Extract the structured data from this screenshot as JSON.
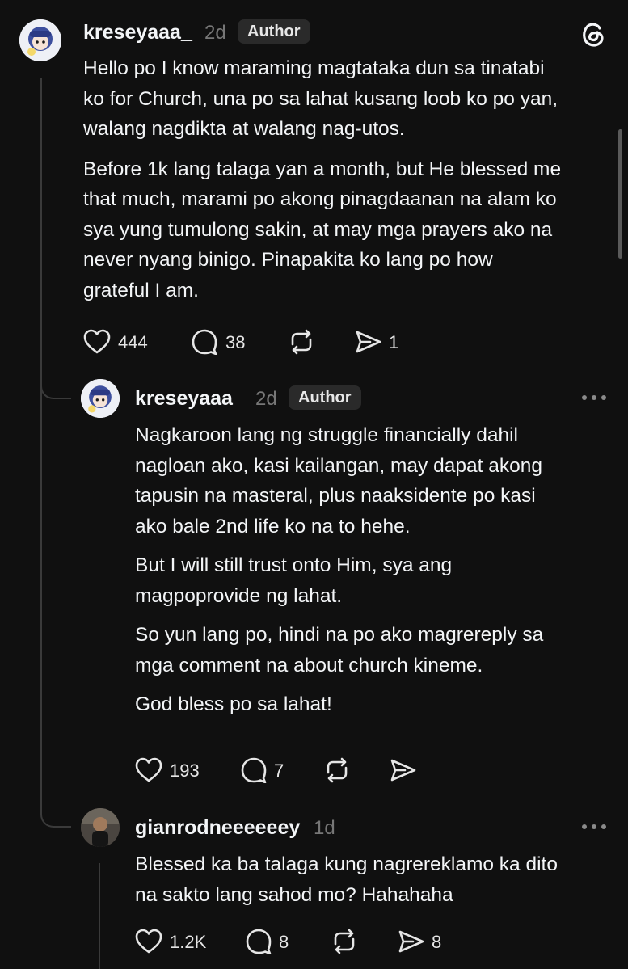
{
  "post": {
    "username": "kreseyaaa_",
    "time": "2d",
    "badge": "Author",
    "paragraphs": [
      [
        "Hello po I know maraming magtataka dun sa tinatabi",
        "ko for Church, una po sa lahat kusang loob ko po yan,",
        "walang nagdikta at walang nag-utos."
      ],
      [
        "Before 1k lang talaga yan a month, but He blessed me",
        "that much, marami po akong pinagdaanan na alam ko",
        "sya yung tumulong sakin, at may mga prayers ako na",
        "never nyang binigo. Pinapakita ko lang po how",
        "grateful I am."
      ]
    ],
    "likes": "444",
    "comments": "38",
    "shares": "1"
  },
  "reply1": {
    "username": "kreseyaaa_",
    "time": "2d",
    "badge": "Author",
    "paragraphs": [
      [
        "Nagkaroon lang ng struggle financially dahil",
        "nagloan ako, kasi kailangan, may dapat akong",
        "tapusin na masteral, plus naaksidente po kasi",
        "ako bale 2nd life ko na to hehe."
      ],
      [
        "But I will still trust onto Him, sya ang",
        "magpoprovide ng lahat."
      ],
      [
        "So yun lang po, hindi na po ako magrereply sa",
        "mga comment na about church kineme."
      ],
      [
        "God bless po sa lahat!"
      ]
    ],
    "likes": "193",
    "comments": "7"
  },
  "reply2": {
    "username": "gianrodneeeeeey",
    "time": "1d",
    "paragraphs": [
      [
        "Blessed ka ba talaga kung nagrereklamo ka dito",
        "na sakto lang sahod mo? Hahahaha"
      ]
    ],
    "likes": "1.2K",
    "comments": "8",
    "shares": "8"
  },
  "colors": {
    "background": "#101010",
    "text": "#f3f5f7",
    "muted": "#777777",
    "badge_bg": "#2a2a2a"
  },
  "icons": [
    "threads-logo-icon",
    "heart-icon",
    "comment-icon",
    "repost-icon",
    "share-icon",
    "more-options-icon"
  ]
}
